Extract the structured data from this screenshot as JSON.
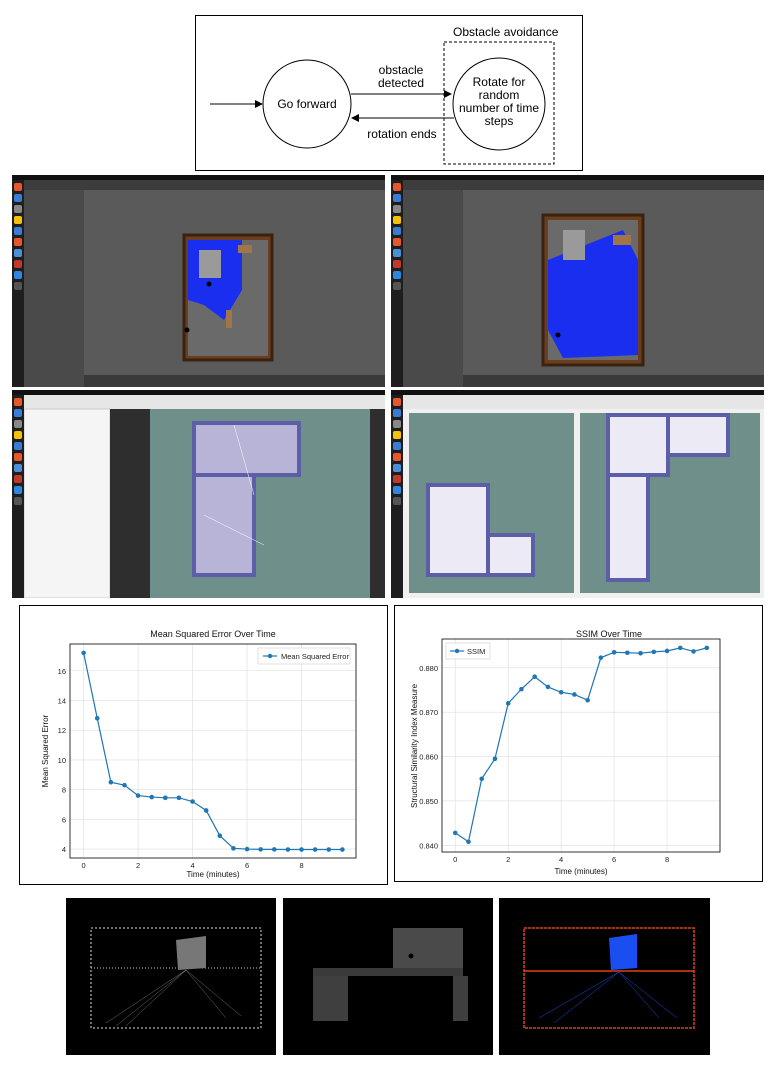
{
  "flowchart": {
    "obstacle_group_label": "Obstacle avoidance",
    "go_forward": "Go forward",
    "obstacle_detected_line1": "obstacle",
    "obstacle_detected_line2": "detected",
    "rotate_line1": "Rotate for",
    "rotate_line2": "random",
    "rotate_line3": "number of time",
    "rotate_line4": "steps",
    "rotation_ends": "rotation ends"
  },
  "colors": {
    "series": "#1f77b4",
    "scan_blue": "#1a2ef0",
    "map_bg": "#6f8f8a",
    "dock_bg": "#1e1e1e"
  },
  "chart_data": [
    {
      "type": "line",
      "title": "Mean Squared Error Over Time",
      "xlabel": "Time (minutes)",
      "ylabel": "Mean Squared Error",
      "legend": "top-right",
      "grid": true,
      "xlim": [
        -0.5,
        10
      ],
      "ylim": [
        3.4,
        17.8
      ],
      "xticks": [
        0,
        2,
        4,
        6,
        8
      ],
      "yticks": [
        4,
        6,
        8,
        10,
        12,
        14,
        16
      ],
      "series": [
        {
          "name": "Mean Squared Error",
          "x": [
            0,
            0.5,
            1,
            1.5,
            2,
            2.5,
            3,
            3.5,
            4,
            4.5,
            5,
            5.5,
            6,
            6.5,
            7,
            7.5,
            8,
            8.5,
            9,
            9.5
          ],
          "y": [
            17.2,
            12.8,
            8.5,
            8.3,
            7.6,
            7.5,
            7.45,
            7.45,
            7.2,
            6.6,
            4.9,
            4.05,
            4.0,
            3.98,
            3.98,
            3.97,
            3.97,
            3.97,
            3.97,
            3.97
          ]
        }
      ]
    },
    {
      "type": "line",
      "title": "SSIM Over Time",
      "xlabel": "Time (minutes)",
      "ylabel": "Structural Similarity Index Measure",
      "legend": "top-left",
      "grid": true,
      "xlim": [
        -0.5,
        10
      ],
      "ylim": [
        0.8385,
        0.8865
      ],
      "xticks": [
        0,
        2,
        4,
        6,
        8
      ],
      "yticks": [
        0.84,
        0.85,
        0.86,
        0.87,
        0.88
      ],
      "series": [
        {
          "name": "SSIM",
          "x": [
            0,
            0.5,
            1,
            1.5,
            2,
            2.5,
            3,
            3.5,
            4,
            4.5,
            5,
            5.5,
            6,
            6.5,
            7,
            7.5,
            8,
            8.5,
            9,
            9.5
          ],
          "y": [
            0.8428,
            0.8408,
            0.855,
            0.8595,
            0.872,
            0.8752,
            0.878,
            0.8757,
            0.8745,
            0.874,
            0.8727,
            0.8823,
            0.8835,
            0.8834,
            0.8833,
            0.8836,
            0.8838,
            0.8845,
            0.8837,
            0.8845
          ]
        }
      ]
    }
  ]
}
